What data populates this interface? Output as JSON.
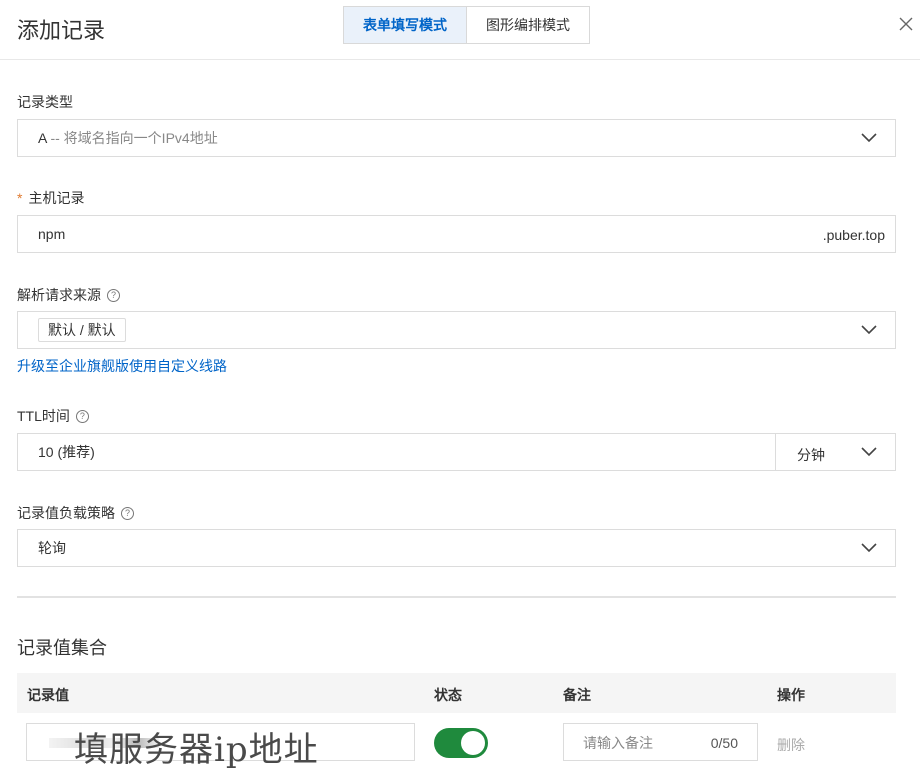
{
  "header": {
    "title": "添加记录",
    "tabs": [
      {
        "label": "表单填写模式",
        "active": true
      },
      {
        "label": "图形编排模式",
        "active": false
      }
    ]
  },
  "record_type": {
    "label": "记录类型",
    "value_prefix": "A",
    "value_desc": " -- 将域名指向一个IPv4地址"
  },
  "host_record": {
    "required_mark": "*",
    "label": "主机记录",
    "value": "npm",
    "suffix": ".puber.top"
  },
  "resolve_source": {
    "label": "解析请求来源",
    "tag": "默认 / 默认",
    "upgrade_link": "升级至企业旗舰版使用自定义线路"
  },
  "ttl": {
    "label": "TTL时间",
    "value": "10 (推荐)",
    "unit": "分钟"
  },
  "load_strategy": {
    "label": "记录值负载策略",
    "value": "轮询"
  },
  "record_set": {
    "title": "记录值集合",
    "columns": [
      "记录值",
      "状态",
      "备注",
      "操作"
    ],
    "row": {
      "value_overlay": "填服务器ip地址",
      "status_on": true,
      "remark_placeholder": "请输入备注",
      "remark_count": "0/50",
      "delete_label": "删除"
    }
  },
  "colors": {
    "accent": "#0064c8",
    "toggle_on": "#1f8a3d",
    "required": "#e07a2f"
  }
}
